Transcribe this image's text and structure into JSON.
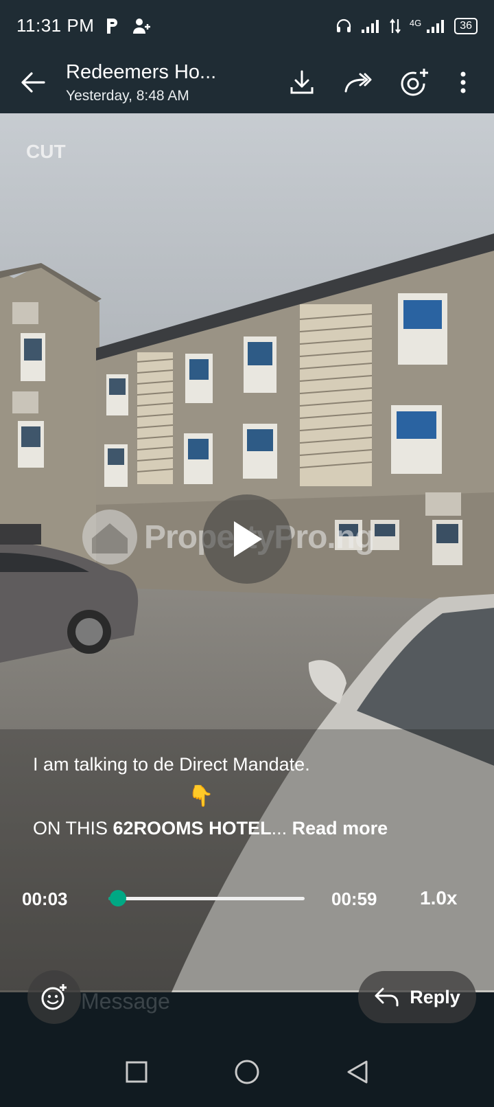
{
  "status_bar": {
    "time": "11:31 PM",
    "battery": "36",
    "network": "4G"
  },
  "header": {
    "title": "Redeemers Ho...",
    "subtitle": "Yesterday, 8:48 AM"
  },
  "video": {
    "editor_badge": "CUT",
    "watermark": "PropertyPro.ng"
  },
  "caption": {
    "line1": "I am talking to de Direct Mandate.",
    "emoji": "👇",
    "line2_prefix": "ON THIS ",
    "line2_bold": "62ROOMS HOTEL",
    "line2_ellipsis": "...",
    "read_more": "Read more"
  },
  "player": {
    "current_time": "00:03",
    "total_time": "00:59",
    "speed": "1.0x",
    "progress_fraction": 0.05
  },
  "composer": {
    "placeholder": "Message",
    "reply_label": "Reply"
  },
  "colors": {
    "accent": "#00a884",
    "header_bg": "#1f2c34",
    "app_bg": "#111b21"
  },
  "icons": [
    "back-arrow-icon",
    "download-icon",
    "forward-icon",
    "status-ring-icon",
    "more-icon",
    "emoji-add-icon",
    "reply-icon",
    "play-icon",
    "nav-square-icon",
    "nav-circle-icon",
    "nav-back-icon"
  ]
}
